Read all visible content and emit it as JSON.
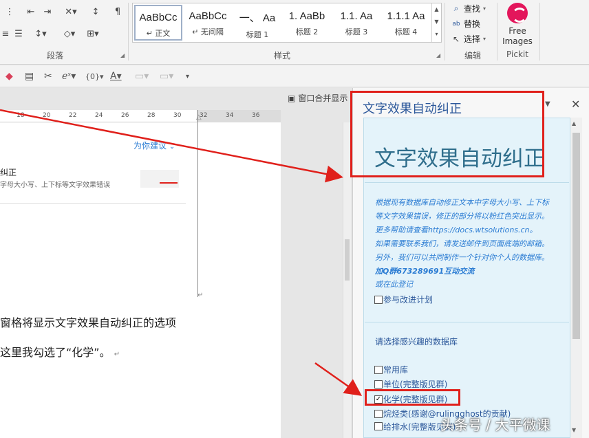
{
  "ribbon": {
    "groups": {
      "paragraph": "段落",
      "styles": "样式",
      "editing": "编辑",
      "pickit": "Pickit"
    },
    "styles_gallery": [
      {
        "sample": "AaBbCc",
        "name": "↵ 正文",
        "active": true
      },
      {
        "sample": "AaBbCc",
        "name": "↵ 无间隔",
        "active": false
      },
      {
        "sample": "一、 Aa",
        "name": "标题 1",
        "active": false
      },
      {
        "sample": "1. AaBb",
        "name": "标题 2",
        "active": false
      },
      {
        "sample": "1.1. Aa",
        "name": "标题 3",
        "active": false
      },
      {
        "sample": "1.1.1 Aa",
        "name": "标题 4",
        "active": false
      }
    ],
    "editing": {
      "find": "查找",
      "replace": "替换",
      "select": "选择"
    },
    "pickit": {
      "line1": "Free",
      "line2": "Images"
    }
  },
  "document": {
    "merge_display": "窗口合并显示",
    "ruler_ticks": [
      "18",
      "20",
      "22",
      "24",
      "26",
      "28",
      "30",
      "32",
      "34",
      "36"
    ],
    "suggest_link": "为你建议",
    "card_title": "纠正",
    "card_desc": "字母大小写、上下标等文字效果错误",
    "body_line1": "窗格将显示文字效果自动纠正的选项",
    "body_line2": "这里我勾选了“化学”。"
  },
  "taskpane": {
    "title": "文字效果自动纠正",
    "big_title": "文字效果自动纠正",
    "description": [
      "根据现有数据库自动修正文本中字母大小写、上下标",
      "等文字效果错误，修正的部分将以粉红色突出显示。",
      "更多帮助请查看https://docs.wtsolutions.cn。",
      "如果需要联系我们，请发送邮件到页面底端的邮箱。",
      "另外，我们可以共同制作一个针对你个人的数据库。"
    ],
    "qq_line": "加Q群673289691互动交流",
    "register": "或在此登记",
    "improve_plan": "参与改进计划",
    "select_heading": "请选择感兴趣的数据库",
    "databases": [
      {
        "label": "常用库",
        "checked": false
      },
      {
        "label": "单位(完整版见群)",
        "checked": false
      },
      {
        "label": "化学(完整版见群)",
        "checked": true
      },
      {
        "label": "烷烃类(感谢@rulingghost的贡献)",
        "checked": false
      },
      {
        "label": "给排水(完整版见群)",
        "checked": false
      }
    ]
  },
  "watermark": "头条号 / 大平微课",
  "colors": {
    "annotation_red": "#e0201b",
    "pane_bg": "#e4f3fa",
    "link_blue": "#2b7cd3",
    "title_blue": "#2b579a"
  }
}
